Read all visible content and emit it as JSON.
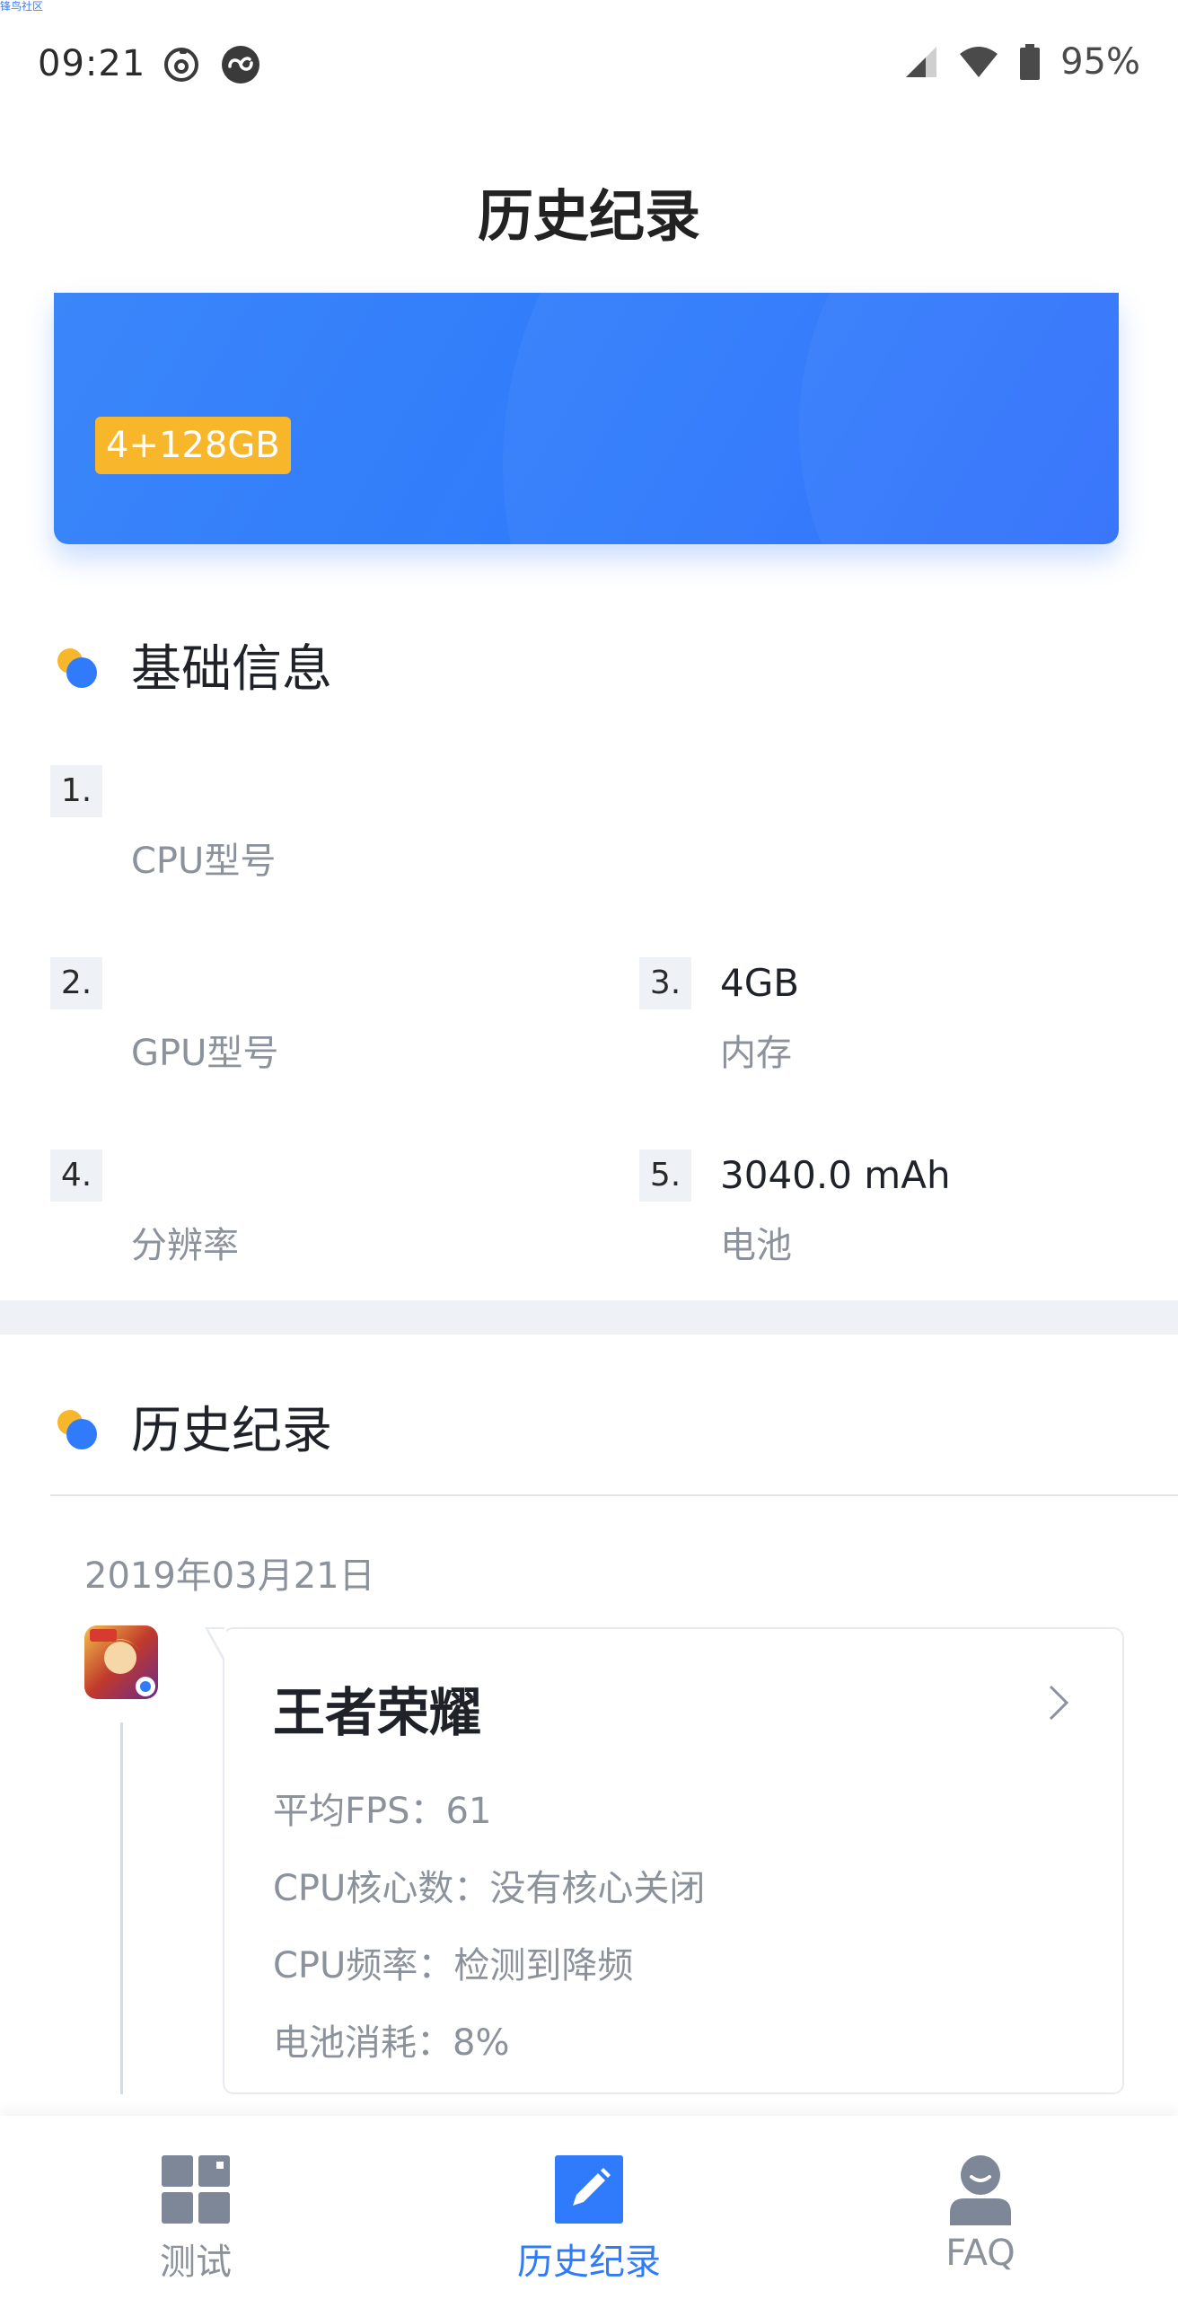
{
  "watermark": "锋鸟社区",
  "status_bar": {
    "time": "09:21",
    "battery": "95%",
    "icons": [
      "netease-music-icon",
      "infinity-app-icon",
      "signal-icon",
      "wifi-icon",
      "battery-icon"
    ]
  },
  "header": {
    "title": "历史纪录"
  },
  "device_card": {
    "spec": "4+128GB"
  },
  "basic_info": {
    "title": "基础信息",
    "items": [
      {
        "num": "1.",
        "value": "",
        "label": "CPU型号"
      },
      {
        "num": "2.",
        "value": "",
        "label": "GPU型号"
      },
      {
        "num": "3.",
        "value": "4GB",
        "label": "内存"
      },
      {
        "num": "4.",
        "value": "",
        "label": "分辨率"
      },
      {
        "num": "5.",
        "value": "3040.0 mAh",
        "label": "电池"
      }
    ]
  },
  "history": {
    "title": "历史纪录",
    "date": "2019年03月21日",
    "records": [
      {
        "game": "王者荣耀",
        "app_icon": "honor-of-kings-icon",
        "stats": [
          "平均FPS：61",
          "CPU核心数：没有核心关闭",
          "CPU频率：检测到降频",
          "电池消耗：8%"
        ]
      }
    ]
  },
  "bottom_nav": {
    "items": [
      {
        "label": "测试",
        "icon": "grid-icon",
        "active": false
      },
      {
        "label": "历史纪录",
        "icon": "edit-icon",
        "active": true
      },
      {
        "label": "FAQ",
        "icon": "user-icon",
        "active": false
      }
    ]
  },
  "colors": {
    "accent": "#2f7bfb",
    "badge": "#f8b62b",
    "muted_text": "#8c929c",
    "inactive_icon": "#7d8798"
  }
}
